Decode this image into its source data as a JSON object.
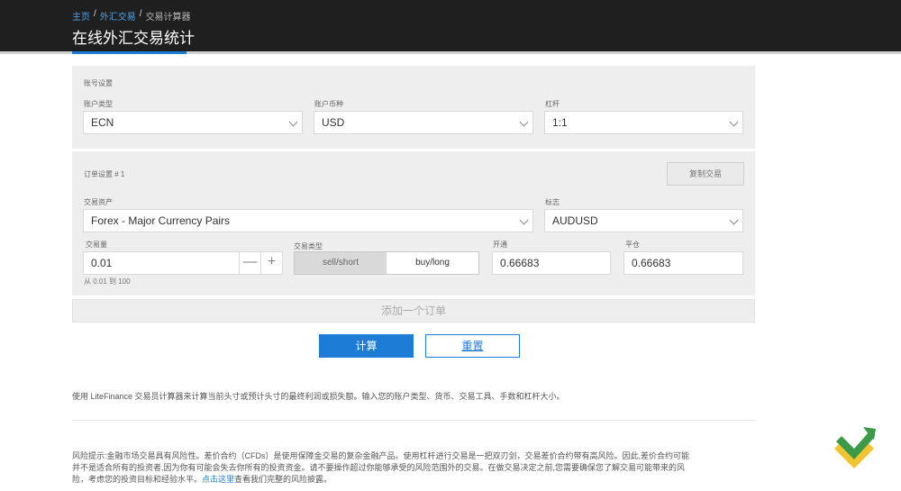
{
  "breadcrumb": {
    "home": "主页",
    "forex": "外汇交易",
    "current": "交易计算器",
    "separator": "/"
  },
  "page_title": "在线外汇交易统计",
  "account": {
    "section_title": "账号设置",
    "type_label": "账户类型",
    "type_value": "ECN",
    "currency_label": "账户币种",
    "currency_value": "USD",
    "leverage_label": "杠杆",
    "leverage_value": "1:1"
  },
  "order": {
    "section_title": "订单设置 # 1",
    "copy_button": "复制交易",
    "asset_label": "交易资产",
    "asset_value": "Forex - Major Currency Pairs",
    "symbol_label": "标志",
    "symbol_value": "AUDUSD",
    "volume_label": "交易量",
    "volume_value": "0.01",
    "volume_minus": "—",
    "volume_plus": "+",
    "volume_hint": "从 0.01 到 100",
    "trade_type_label": "交易类型",
    "sell_label": "sell/short",
    "buy_label": "buy/long",
    "open_label": "开通",
    "open_value": "0.66683",
    "close_label": "平仓",
    "close_value": "0.66683"
  },
  "add_order_button": "添加一个订单",
  "calculate_button": "计算",
  "reset_button": "重置",
  "intro_text": "使用 LiteFinance 交易员计算器来计算当前头寸或预计头寸的最终利润或损失额。输入您的账户类型、货币、交易工具、手数和杠杆大小。",
  "risk": {
    "line1": "风险提示:金融市场交易具有风险性。差价合约（CFDs）是使用保障金交易的复杂金融产品。使用杠杆进行交易是一把双刃剑，交易差价合约带有高风险。因此,差价合约可能",
    "line2": "并不是适合所有的投资者,因为你有可能会失去你所有的投资资金。请不要操作超过你能够承受的风险范围外的交易。在做交易决定之前,您需要确保您了解交易可能带来的风",
    "line3_start": "险，考虑您的投资目标和经验水平。",
    "link": "点击这里",
    "line3_end": "查看我们完整的风险披露。"
  },
  "colors": {
    "accent": "#1c7cd6",
    "header_bg": "#1f1f1f",
    "logo_green": "#3a9a47",
    "logo_yellow": "#f2c432"
  },
  "icons": {
    "select_arrow": "chevron-down-icon",
    "logo": "litefinance-logo-icon"
  }
}
